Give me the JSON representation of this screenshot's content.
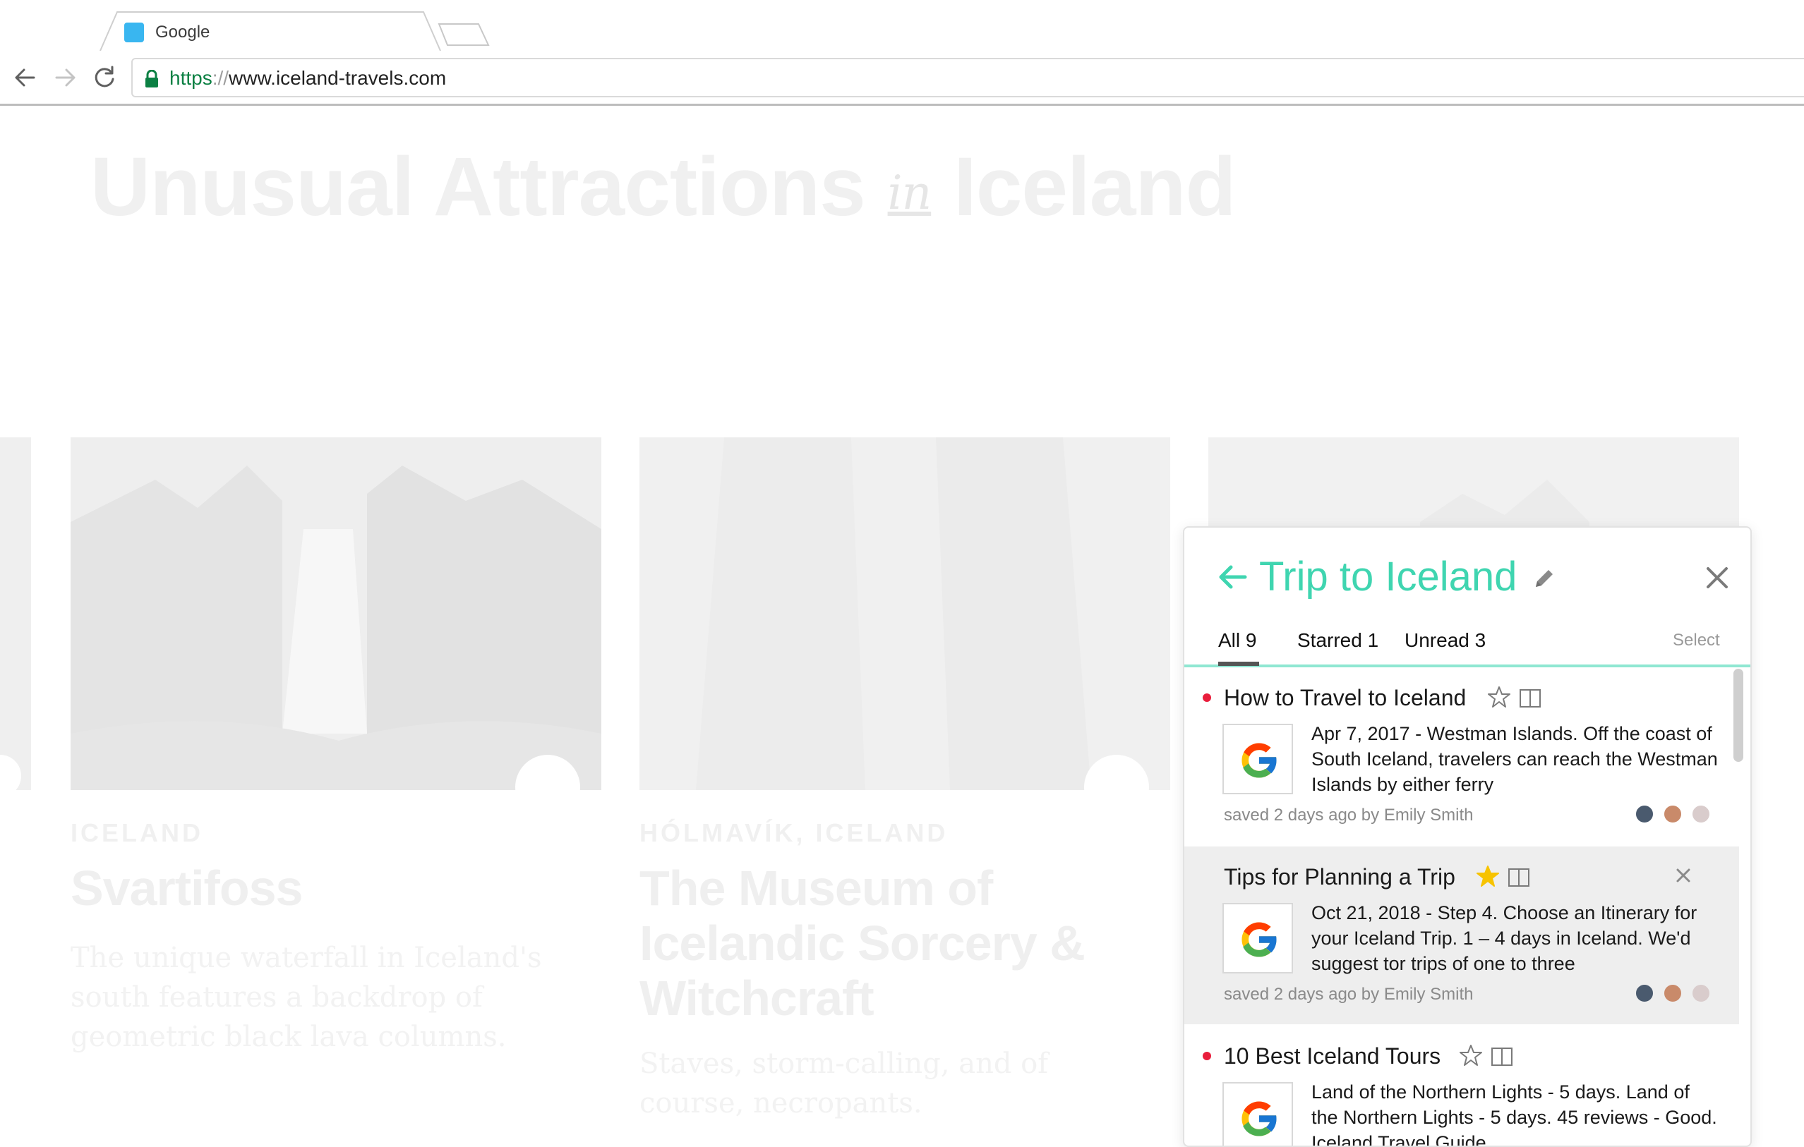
{
  "browser": {
    "tab_title": "Google",
    "url_scheme": "https",
    "url_sep": "://",
    "url_host": "www.iceland-travels.com"
  },
  "page": {
    "title_left": "Unusual Attractions",
    "title_in": "in",
    "title_right": "Iceland",
    "cards": [
      {
        "location": "ICELAND",
        "name": "Svartifoss",
        "description": "The unique waterfall in Iceland's south features a backdrop of geometric black lava columns."
      },
      {
        "location": "HÓLMAVÍK, ICELAND",
        "name": "The Museum of Icelandic Sorcery & Witchcraft",
        "description": "Staves, storm-calling, and of course, necropants."
      }
    ]
  },
  "panel": {
    "title": "Trip to Iceland",
    "tabs": [
      {
        "label": "All 9"
      },
      {
        "label": "Starred 1"
      },
      {
        "label": "Unread 3"
      }
    ],
    "select_label": "Select",
    "items": [
      {
        "title": "How to Travel to Iceland",
        "starred": false,
        "unread": true,
        "snippet": "Apr 7, 2017 - Westman Islands. Off the coast of South Iceland, travelers can reach the Westman Islands by either ferry",
        "meta": "saved 2 days ago by Emily Smith"
      },
      {
        "title": "Tips for Planning a Trip",
        "starred": true,
        "unread": false,
        "snippet": "Oct 21, 2018 - Step 4. Choose an Itinerary for your Iceland Trip. 1 – 4 days in Iceland. We'd suggest tor trips of one to three",
        "meta": "saved 2 days ago by Emily Smith"
      },
      {
        "title": "10 Best Iceland Tours",
        "starred": false,
        "unread": true,
        "snippet": "Land of the Northern Lights - 5 days. Land of the Northern Lights - 5 days. 45 reviews - Good. Iceland Travel Guide",
        "meta": ""
      }
    ]
  },
  "colors": {
    "accent": "#3fd5b0",
    "unread_dot": "#e91e3c",
    "star_filled": "#f7c300",
    "secure_green": "#0b8043"
  }
}
